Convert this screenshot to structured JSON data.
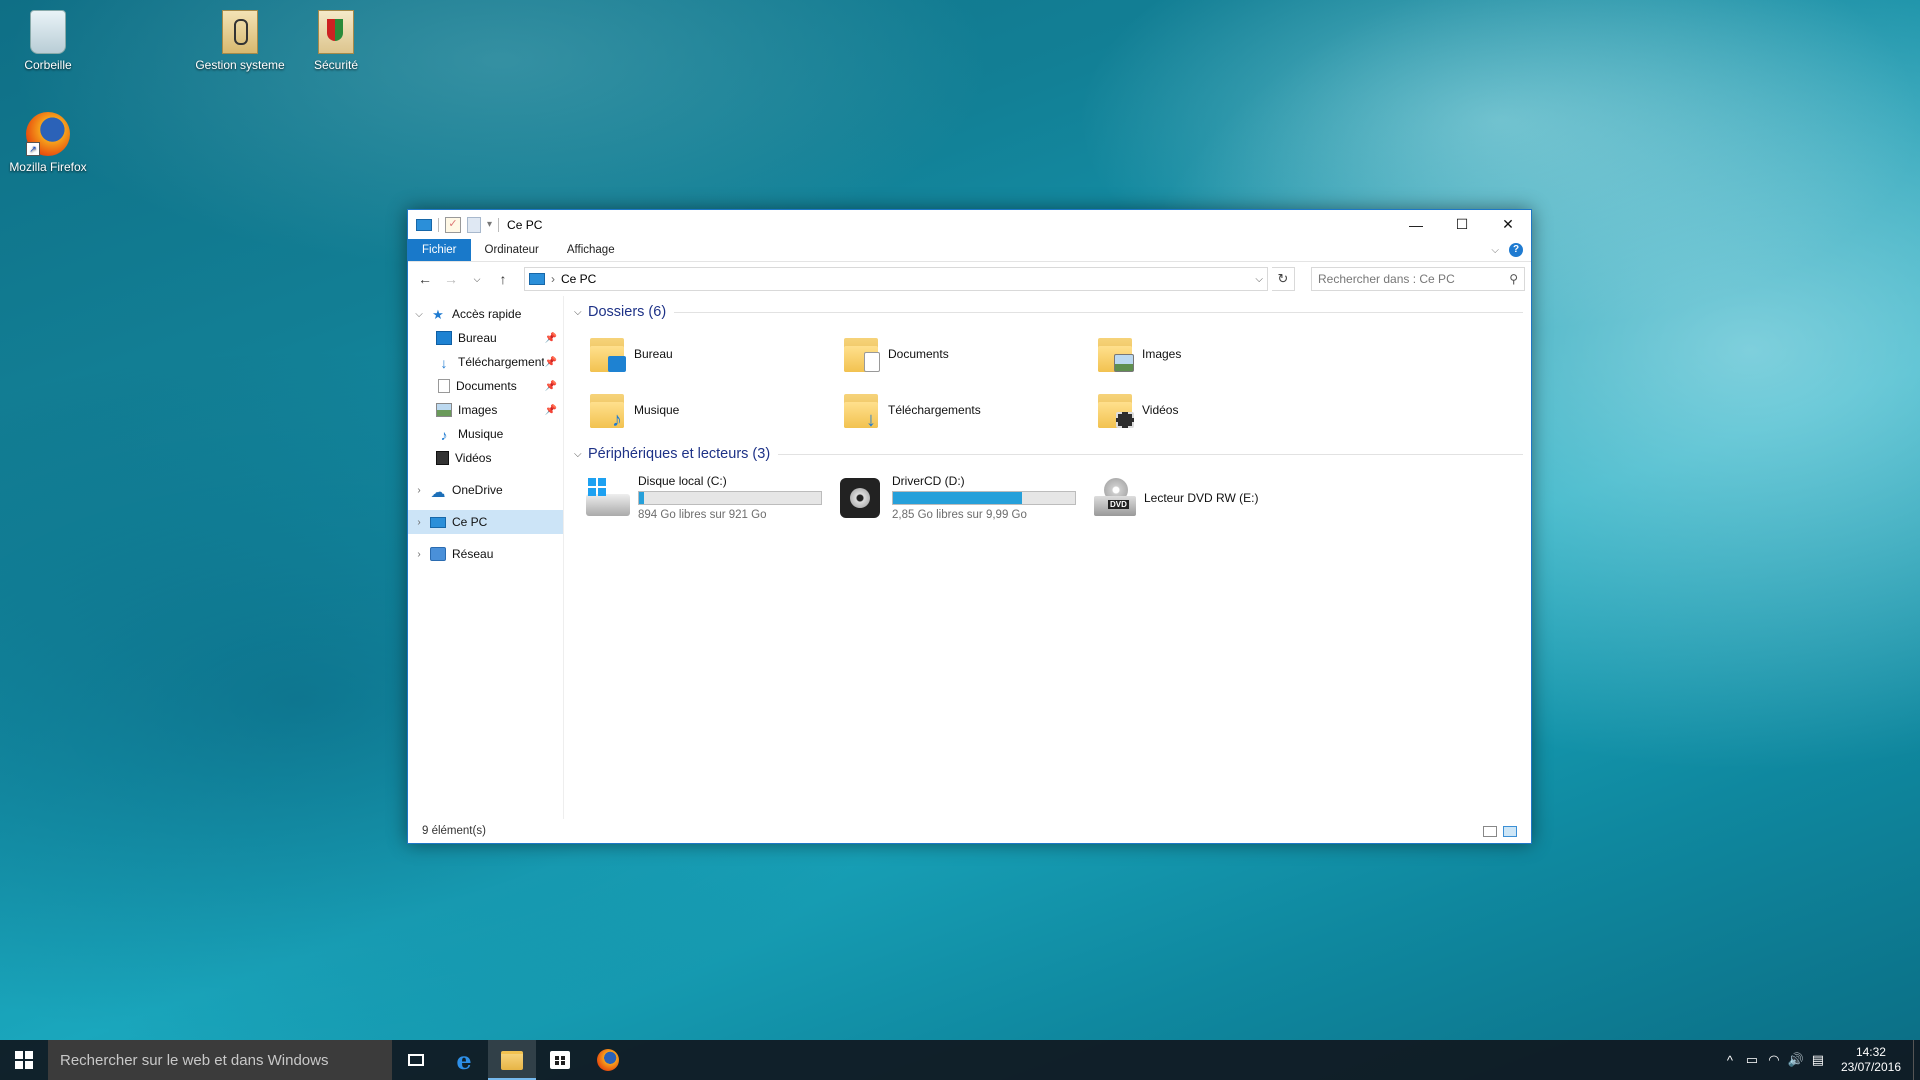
{
  "desktop": {
    "icons": [
      {
        "label": "Corbeille",
        "icon": "recycle-bin-icon"
      },
      {
        "label": "Gestion systeme",
        "icon": "file-icon"
      },
      {
        "label": "Sécurité",
        "icon": "file-icon"
      },
      {
        "label": "Mozilla Firefox",
        "icon": "firefox-icon"
      }
    ]
  },
  "window": {
    "title": "Ce PC",
    "ribbon_tabs": [
      "Fichier",
      "Ordinateur",
      "Affichage"
    ],
    "address": {
      "path": "Ce PC"
    },
    "search": {
      "placeholder": "Rechercher dans : Ce PC"
    },
    "nav": {
      "quick_access": "Accès rapide",
      "quick_items": [
        "Bureau",
        "Téléchargements",
        "Documents",
        "Images",
        "Musique",
        "Vidéos"
      ],
      "onedrive": "OneDrive",
      "this_pc": "Ce PC",
      "network": "Réseau"
    },
    "folders_header": "Dossiers (6)",
    "folders": [
      "Bureau",
      "Documents",
      "Images",
      "Musique",
      "Téléchargements",
      "Vidéos"
    ],
    "drives_header": "Périphériques et lecteurs (3)",
    "drives": [
      {
        "name": "Disque local (C:)",
        "sub": "894 Go libres sur 921 Go",
        "used_fraction": 0.03
      },
      {
        "name": "DriverCD (D:)",
        "sub": "2,85 Go libres sur 9,99 Go",
        "used_fraction": 0.71
      },
      {
        "name": "Lecteur DVD RW (E:)"
      }
    ],
    "status": "9 élément(s)"
  },
  "taskbar": {
    "search_placeholder": "Rechercher sur le web et dans Windows",
    "time": "14:32",
    "date": "23/07/2016"
  },
  "colors": {
    "accent": "#1979ca",
    "drive_bar": "#26a0da"
  }
}
